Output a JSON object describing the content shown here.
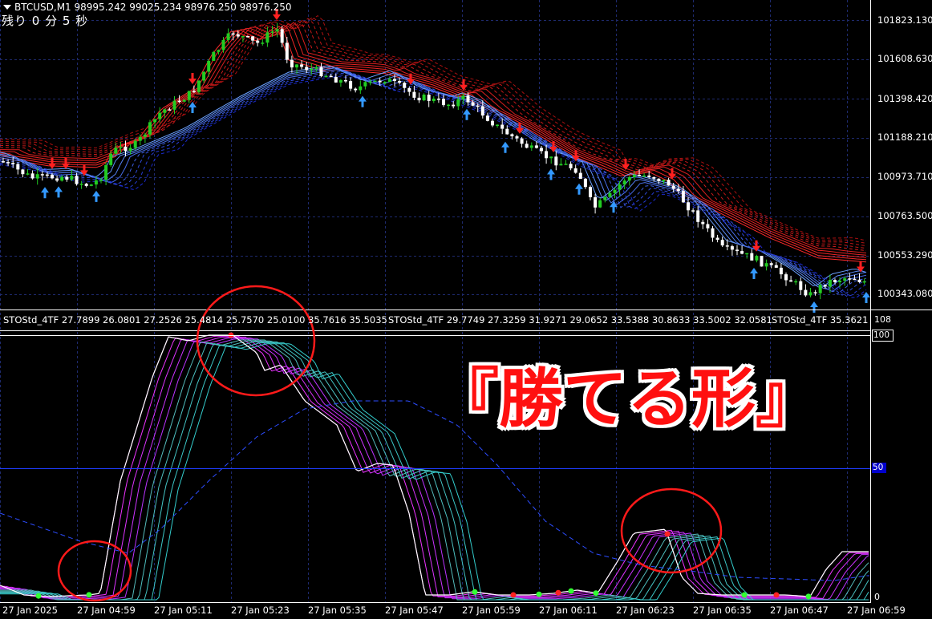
{
  "main": {
    "symbol": "BTCUSD,M1",
    "ohlc": "98995.242 99025.234 98976.250 98976.250",
    "countdown": "残り 0 分 5 秒",
    "price_axis": [
      "101823.130",
      "101608.630",
      "101398.420",
      "101188.210",
      "100973.710",
      "100763.500",
      "100553.290",
      "100343.080"
    ]
  },
  "indicator": {
    "title_1": "STOStd_4TF 27.7899 26.0801 27.2526 25.4814 25.7570 25.0100 35.7616 35.5035",
    "title_2": "STOStd_4TF 29.7749 27.3259 31.9271 29.0652 33.5388 30.8633 33.5002 32.0581",
    "title_3": "STOStd_4TF 35.3621",
    "scale_top": "108",
    "level_100": "100",
    "level_50": "50",
    "scale_bottom": "0"
  },
  "time_axis": [
    "27 Jan 2025",
    "27 Jan 04:59",
    "27 Jan 05:11",
    "27 Jan 05:23",
    "27 Jan 05:35",
    "27 Jan 05:47",
    "27 Jan 05:59",
    "27 Jan 06:11",
    "27 Jan 06:23",
    "27 Jan 06:35",
    "27 Jan 06:47",
    "27 Jan 06:59"
  ],
  "annotation": "『勝てる形』",
  "colors": {
    "bull": "#22cc22",
    "bear": "#ffffff",
    "down_arrow": "#ff2020",
    "up_arrow": "#3399ff",
    "grid": "#1e2a6e",
    "circle": "#ff1a1a",
    "ribbon_upper": "#ff3030",
    "ribbon_lower": "#3355ff",
    "stoch_fast": "#ff33ff",
    "stoch_slow": "#33cccc"
  }
}
